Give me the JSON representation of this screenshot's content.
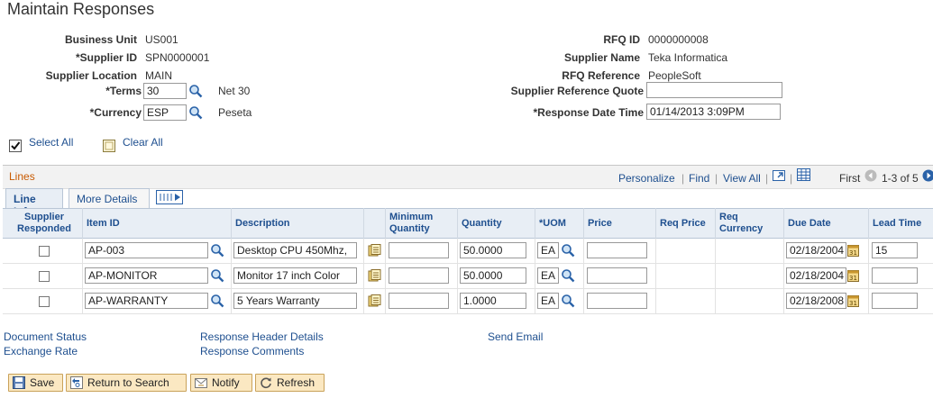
{
  "page": {
    "title": "Maintain Responses"
  },
  "header": {
    "business_unit_label": "Business Unit",
    "business_unit": "US001",
    "supplier_id_label": "*Supplier ID",
    "supplier_id": "SPN0000001",
    "supplier_location_label": "Supplier Location",
    "supplier_location": "MAIN",
    "terms_label": "*Terms",
    "terms": "30",
    "terms_desc": "Net 30",
    "currency_label": "*Currency",
    "currency": "ESP",
    "currency_desc": "Peseta",
    "rfq_id_label": "RFQ ID",
    "rfq_id": "0000000008",
    "supplier_name_label": "Supplier Name",
    "supplier_name": "Teka Informatica",
    "rfq_reference_label": "RFQ Reference",
    "rfq_reference": "PeopleSoft",
    "supplier_ref_quote_label": "Supplier Reference Quote",
    "supplier_ref_quote": "",
    "response_dt_label": "*Response Date Time",
    "response_dt": "01/14/2013  3:09PM"
  },
  "select": {
    "select_all": "Select All",
    "clear_all": "Clear All"
  },
  "grid": {
    "title": "Lines",
    "personalize": "Personalize",
    "find": "Find",
    "view_all": "View All",
    "first": "First",
    "range": "1-3 of 5",
    "tabs": [
      "Line Info",
      "More Details"
    ],
    "columns": [
      "Supplier Responded",
      "Item ID",
      "Description",
      "Minimum Quantity",
      "Quantity",
      "*UOM",
      "Price",
      "Req Price",
      "Req Currency",
      "Due Date",
      "Lead Time"
    ],
    "rows": [
      {
        "item_id": "AP-003",
        "description": "Desktop CPU 450Mhz,",
        "min_qty": "",
        "quantity": "50.0000",
        "uom": "EA",
        "price": "",
        "due_date": "02/18/2004",
        "lead_time": "15"
      },
      {
        "item_id": "AP-MONITOR",
        "description": "Monitor  17 inch Color",
        "min_qty": "",
        "quantity": "50.0000",
        "uom": "EA",
        "price": "",
        "due_date": "02/18/2004",
        "lead_time": ""
      },
      {
        "item_id": "AP-WARRANTY",
        "description": "5 Years Warranty",
        "min_qty": "",
        "quantity": "1.0000",
        "uom": "EA",
        "price": "",
        "due_date": "02/18/2008",
        "lead_time": ""
      }
    ]
  },
  "links": {
    "document_status": "Document Status",
    "exchange_rate": "Exchange Rate",
    "response_header_details": "Response Header Details",
    "response_comments": "Response Comments",
    "send_email": "Send Email"
  },
  "toolbar": {
    "save": "Save",
    "return_to_search": "Return to Search",
    "notify": "Notify",
    "refresh": "Refresh"
  },
  "colors": {
    "link": "#1e4f8f",
    "grid_title": "#c85a00",
    "button_bg": "#fbe8c2"
  }
}
